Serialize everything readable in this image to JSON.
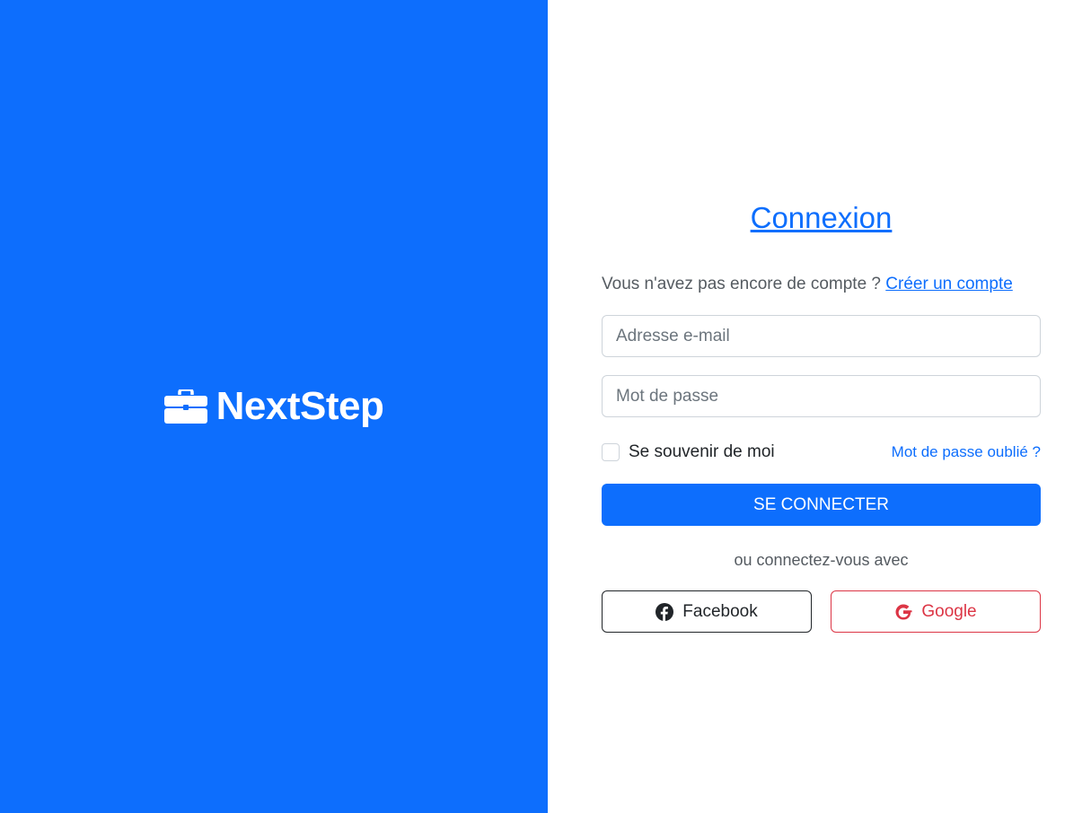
{
  "brand": {
    "name": "NextStep",
    "icon": "briefcase-icon",
    "background_color": "#0d6efd"
  },
  "login": {
    "title": "Connexion",
    "signup_prompt": "Vous n'avez pas encore de compte ?",
    "signup_link": "Créer un compte",
    "email_placeholder": "Adresse e-mail",
    "password_placeholder": "Mot de passe",
    "remember_label": "Se souvenir de moi",
    "forgot_link": "Mot de passe oublié ?",
    "submit_label": "SE CONNECTER",
    "alt_text": "ou connectez-vous avec",
    "social": {
      "facebook_label": "Facebook",
      "google_label": "Google"
    }
  },
  "colors": {
    "primary": "#0d6efd",
    "danger": "#dc3545",
    "dark": "#212529"
  }
}
